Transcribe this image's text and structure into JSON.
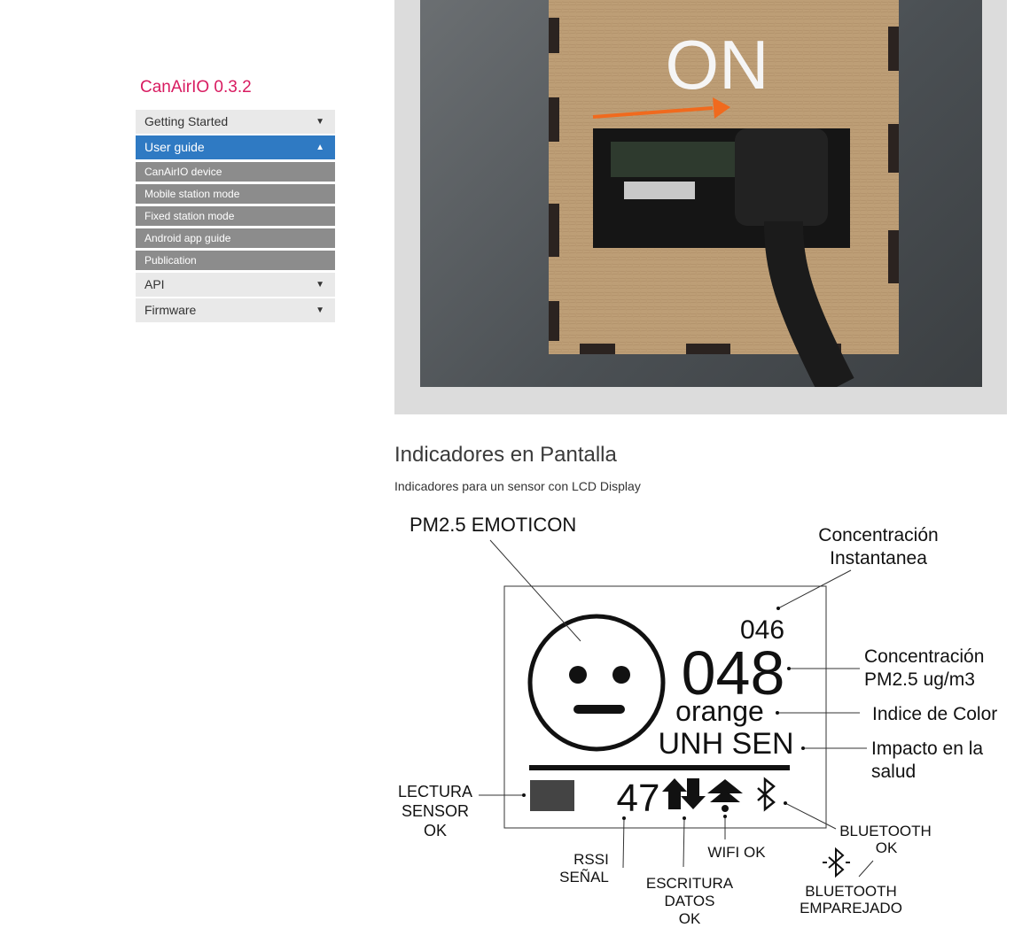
{
  "sidebar": {
    "brand": "CanAirIO 0.3.2",
    "items": [
      {
        "label": "Getting Started",
        "caret": "▼",
        "active": false
      },
      {
        "label": "User guide",
        "caret": "▲",
        "active": true,
        "children": [
          "CanAirIO device",
          "Mobile station mode",
          "Fixed station mode",
          "Android app guide",
          "Publication"
        ]
      },
      {
        "label": "API",
        "caret": "▼",
        "active": false
      },
      {
        "label": "Firmware",
        "caret": "▼",
        "active": false
      }
    ]
  },
  "photo": {
    "overlay_text": "ON"
  },
  "content": {
    "heading": "Indicadores en Pantalla",
    "paragraph": "Indicadores para un sensor con LCD Display"
  },
  "diagram": {
    "labels": {
      "emoticon": "PM2.5 EMOTICON",
      "conc_inst_1": "Concentración",
      "conc_inst_2": "Instantanea",
      "conc_pm_1": "Concentración",
      "conc_pm_2": "PM2.5 ug/m3",
      "color_index": "Indice de Color",
      "impact_1": "Impacto en la",
      "impact_2": "salud",
      "lectura_1": "LECTURA",
      "lectura_2": "SENSOR",
      "lectura_3": "OK",
      "rssi_1": "RSSI",
      "rssi_2": "SEÑAL",
      "escritura_1": "ESCRITURA",
      "escritura_2": "DATOS",
      "escritura_3": "OK",
      "wifi": "WIFI OK",
      "bt_ok_1": "BLUETOOTH",
      "bt_ok_2": "OK",
      "bt_pair_1": "BLUETOOTH",
      "bt_pair_2": "EMPAREJADO"
    },
    "display": {
      "small_value": "046",
      "big_value": "048",
      "color_word": "orange",
      "health": "UNH SEN",
      "rssi_value": "47"
    }
  }
}
